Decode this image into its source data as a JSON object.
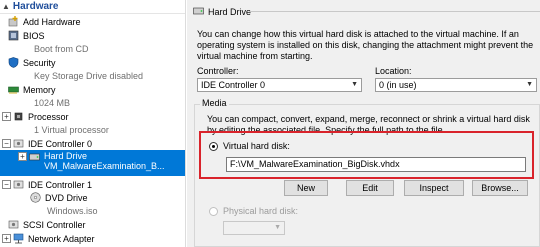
{
  "tree": {
    "section_title": "Hardware",
    "items": [
      {
        "label": "Add Hardware",
        "sub": ""
      },
      {
        "label": "BIOS",
        "sub": "Boot from CD"
      },
      {
        "label": "Security",
        "sub": "Key Storage Drive disabled"
      },
      {
        "label": "Memory",
        "sub": "1024 MB"
      },
      {
        "label": "Processor",
        "sub": "1 Virtual processor"
      },
      {
        "label": "IDE Controller 0",
        "sub": ""
      },
      {
        "label": "Hard Drive",
        "sub": "VM_MalwareExamination_B..."
      },
      {
        "label": "IDE Controller 1",
        "sub": ""
      },
      {
        "label": "DVD Drive",
        "sub": "Windows.iso"
      },
      {
        "label": "SCSI Controller",
        "sub": ""
      },
      {
        "label": "Network Adapter",
        "sub": ""
      }
    ]
  },
  "pane": {
    "title": "Hard Drive",
    "description": "You can change how this virtual hard disk is attached to the virtual machine. If an operating system is installed on this disk, changing the attachment might prevent the virtual machine from starting.",
    "controller_label": "Controller:",
    "controller_value": "IDE Controller 0",
    "location_label": "Location:",
    "location_value": "0 (in use)",
    "media_title": "Media",
    "media_desc": "You can compact, convert, expand, merge, reconnect or shrink a virtual hard disk by editing the associated file. Specify the full path to the file.",
    "vhd_label": "Virtual hard disk:",
    "vhd_path": "F:\\VM_MalwareExamination_BigDisk.vhdx",
    "buttons": {
      "new": "New",
      "edit": "Edit",
      "inspect": "Inspect",
      "browse": "Browse..."
    },
    "physical_label": "Physical hard disk:"
  }
}
